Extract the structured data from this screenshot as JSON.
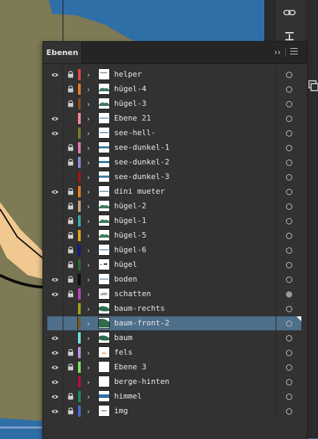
{
  "panel": {
    "tab_label": "Ebenen",
    "collapse_label": "››",
    "icons": {
      "menu": "hamburger-menu-icon",
      "visibility": "eye-icon",
      "lock": "lock-icon",
      "expand": "chevron-right-icon",
      "target": "target-circle-icon"
    }
  },
  "dock": {
    "icons": [
      "link-icon",
      "align-icon",
      "layers-icon",
      "transform-icon"
    ]
  },
  "colors": {
    "panel_bg": "#323232",
    "selection": "#4e6f8a",
    "water": "#2f6fa8",
    "land": "#7d7a55",
    "sand": "#f0c890"
  },
  "layers": [
    {
      "name": "helper",
      "visible": true,
      "locked": true,
      "color": "#d94a4a",
      "thumb": "helper",
      "target_filled": false,
      "selected": false
    },
    {
      "name": "hügel-4",
      "visible": false,
      "locked": true,
      "color": "#e07a2a",
      "thumb": "hill",
      "target_filled": false,
      "selected": false
    },
    {
      "name": "hügel-3",
      "visible": false,
      "locked": true,
      "color": "#8a4b22",
      "thumb": "hill",
      "target_filled": false,
      "selected": false
    },
    {
      "name": "Ebene 21",
      "visible": true,
      "locked": false,
      "color": "#f08a9a",
      "thumb": "line",
      "target_filled": false,
      "selected": false
    },
    {
      "name": "see-hell-",
      "visible": true,
      "locked": false,
      "color": "#7a7a2a",
      "thumb": "line",
      "target_filled": false,
      "selected": false
    },
    {
      "name": "see-dunkel-1",
      "visible": false,
      "locked": true,
      "color": "#e07ab0",
      "thumb": "water",
      "target_filled": false,
      "selected": false
    },
    {
      "name": "see-dunkel-2",
      "visible": false,
      "locked": true,
      "color": "#8a8ad0",
      "thumb": "water",
      "target_filled": false,
      "selected": false
    },
    {
      "name": "see-dunkel-3",
      "visible": false,
      "locked": false,
      "color": "#a01818",
      "thumb": "water",
      "target_filled": false,
      "selected": false
    },
    {
      "name": "dini mueter",
      "visible": true,
      "locked": true,
      "color": "#e8801a",
      "thumb": "line",
      "target_filled": false,
      "selected": false
    },
    {
      "name": "hügel-2",
      "visible": false,
      "locked": true,
      "color": "#c9a07a",
      "thumb": "hill",
      "target_filled": false,
      "selected": false
    },
    {
      "name": "hügel-1",
      "visible": false,
      "locked": true,
      "color": "#3aa8a8",
      "thumb": "hill",
      "target_filled": false,
      "selected": false
    },
    {
      "name": "hügel-5",
      "visible": false,
      "locked": true,
      "color": "#e0a020",
      "thumb": "hill",
      "target_filled": false,
      "selected": false
    },
    {
      "name": "hügel-6",
      "visible": false,
      "locked": true,
      "color": "#1a1a8a",
      "thumb": "line",
      "target_filled": false,
      "selected": false
    },
    {
      "name": "hügel",
      "visible": false,
      "locked": true,
      "color": "#2a6a2a",
      "thumb": "dots",
      "target_filled": false,
      "selected": false
    },
    {
      "name": "boden",
      "visible": true,
      "locked": true,
      "color": "#101010",
      "thumb": "line",
      "target_filled": false,
      "selected": false
    },
    {
      "name": "schatten",
      "visible": true,
      "locked": true,
      "color": "#c040c0",
      "thumb": "shadow",
      "target_filled": true,
      "selected": false
    },
    {
      "name": "baum-rechts",
      "visible": false,
      "locked": false,
      "color": "#a0a020",
      "thumb": "tree",
      "target_filled": false,
      "selected": false
    },
    {
      "name": "baum-front-2",
      "visible": false,
      "locked": false,
      "color": "#7a5a20",
      "thumb": "tree-big",
      "target_filled": false,
      "selected": true
    },
    {
      "name": "baum",
      "visible": true,
      "locked": false,
      "color": "#70e0e0",
      "thumb": "tree",
      "target_filled": false,
      "selected": false
    },
    {
      "name": "fels",
      "visible": true,
      "locked": true,
      "color": "#c090e0",
      "thumb": "rock",
      "target_filled": false,
      "selected": false
    },
    {
      "name": "Ebene 3",
      "visible": true,
      "locked": true,
      "color": "#80e060",
      "thumb": "blank",
      "target_filled": false,
      "selected": false
    },
    {
      "name": "berge-hinten",
      "visible": true,
      "locked": false,
      "color": "#b01040",
      "thumb": "blank",
      "target_filled": false,
      "selected": false
    },
    {
      "name": "himmel",
      "visible": true,
      "locked": true,
      "color": "#1a8a5a",
      "thumb": "sky",
      "target_filled": false,
      "selected": false
    },
    {
      "name": "img",
      "visible": true,
      "locked": true,
      "color": "#4a6ad0",
      "thumb": "img",
      "target_filled": false,
      "selected": false
    }
  ]
}
